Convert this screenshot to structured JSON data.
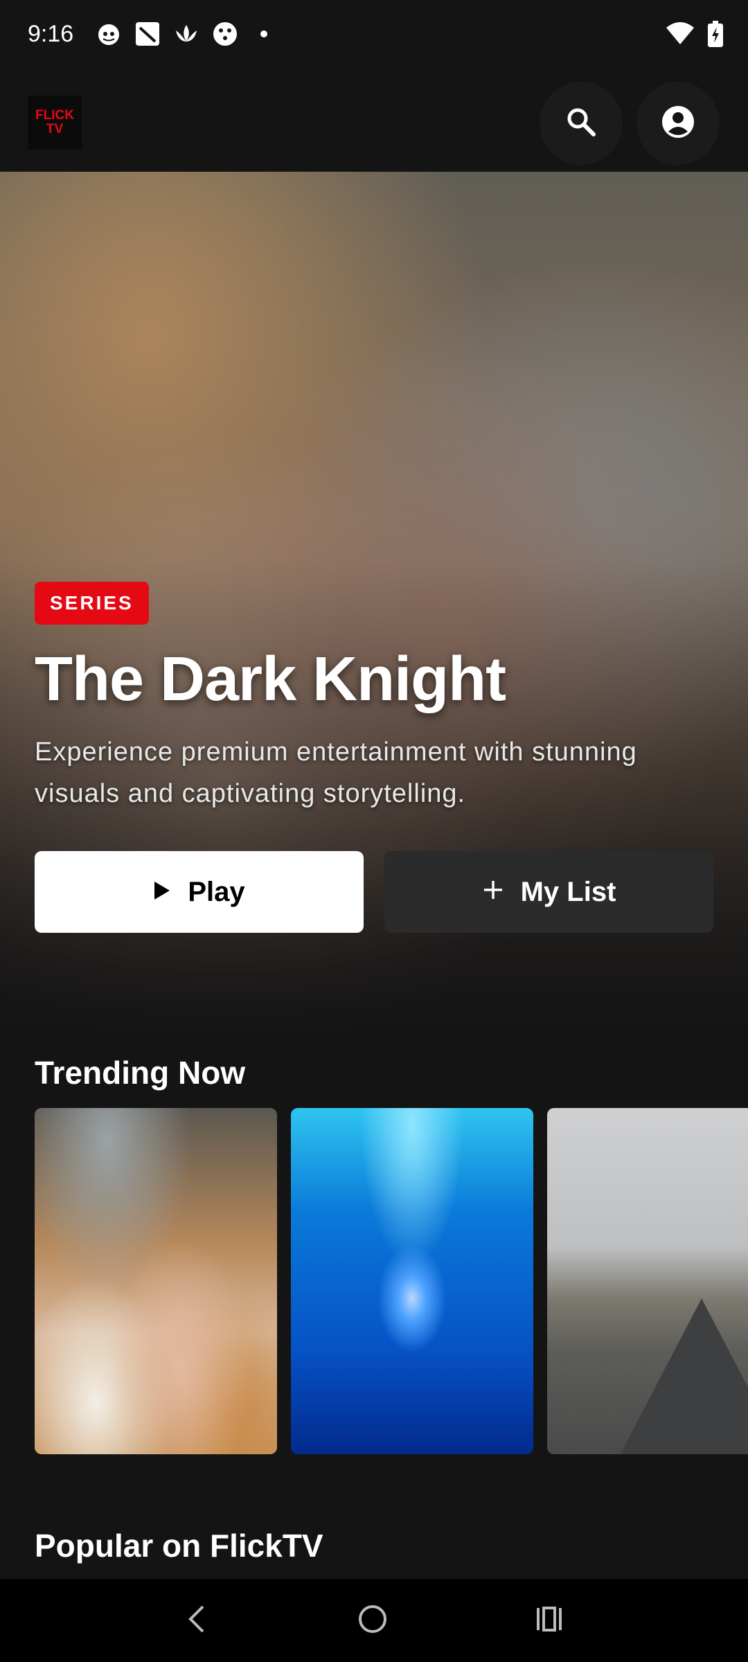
{
  "status_bar": {
    "time": "9:16",
    "notification_icons": [
      "cat-icon",
      "word-icon",
      "lotus-icon",
      "wd-icon",
      "dot-icon"
    ],
    "system_icons": [
      "wifi-icon",
      "battery-charging-icon"
    ]
  },
  "app_bar": {
    "logo_line1": "FLICK",
    "logo_line2": "TV",
    "actions": [
      "search-icon",
      "account-icon"
    ]
  },
  "hero": {
    "badge": "SERIES",
    "title": "The Dark Knight",
    "description": "Experience premium entertainment with stunning visuals and captivating storytelling.",
    "play_label": "Play",
    "my_list_label": "My List"
  },
  "sections": {
    "trending_title": "Trending Now",
    "popular_title": "Popular on FlickTV"
  },
  "trending_cards": [
    {
      "image": "hands-writing-notebook"
    },
    {
      "image": "jellyfish-underwater"
    },
    {
      "image": "empty-road-landscape"
    }
  ],
  "colors": {
    "accent": "#e50914",
    "background": "#141414",
    "secondary_button": "#2b2b2b"
  },
  "nav_bar": {
    "buttons": [
      "back-icon",
      "home-icon",
      "recents-icon"
    ]
  }
}
